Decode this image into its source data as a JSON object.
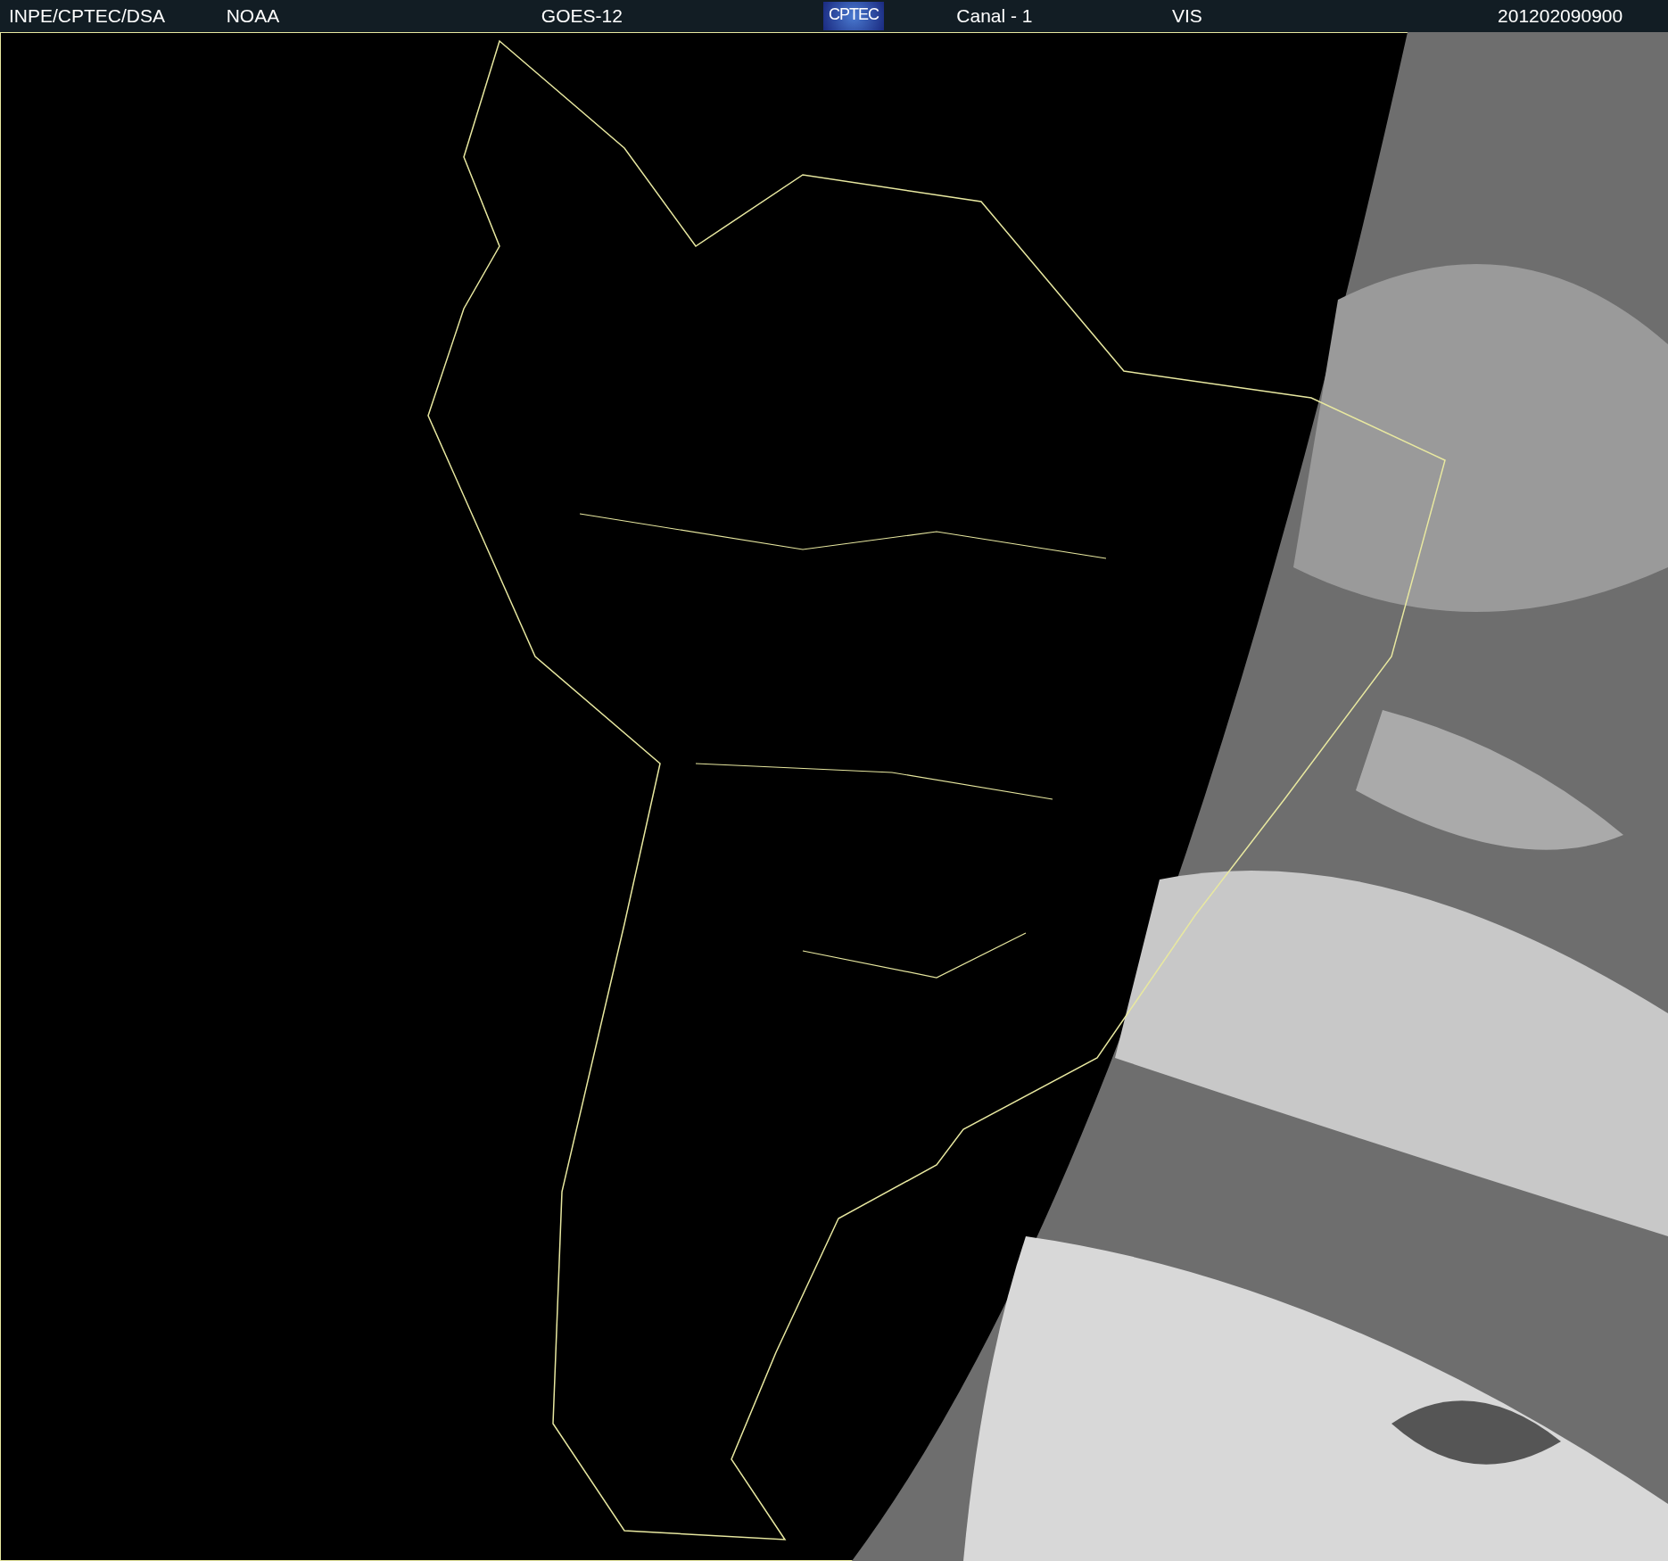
{
  "header": {
    "items": [
      {
        "kind": "text",
        "text": "INPE/CPTEC/DSA"
      },
      {
        "kind": "text",
        "text": "NOAA"
      },
      {
        "kind": "text",
        "text": "GOES-12"
      },
      {
        "kind": "logo",
        "text": "CPTEC"
      },
      {
        "kind": "text",
        "text": "Canal - 1"
      },
      {
        "kind": "text",
        "text": "VIS"
      },
      {
        "kind": "text",
        "text": "201202090900"
      }
    ]
  }
}
